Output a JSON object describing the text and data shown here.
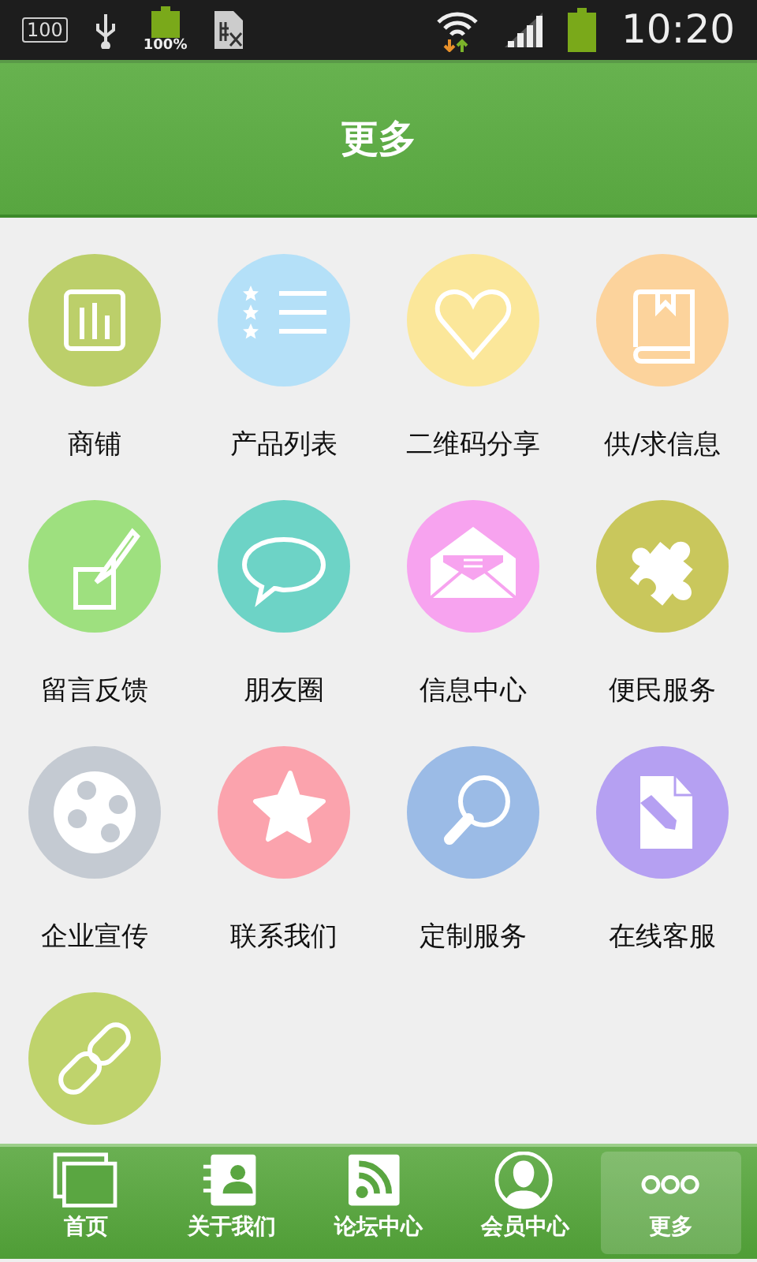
{
  "status_bar": {
    "notification_count": "100",
    "battery_percent": "100%",
    "time": "10:20"
  },
  "header": {
    "title": "更多"
  },
  "items": [
    {
      "label": "商铺",
      "color": "#bccf6a"
    },
    {
      "label": "产品列表",
      "color": "#b4e0f8"
    },
    {
      "label": "二维码分享",
      "color": "#fbe79a"
    },
    {
      "label": "供/求信息",
      "color": "#fcd39c"
    },
    {
      "label": "留言反馈",
      "color": "#9ee07f"
    },
    {
      "label": "朋友圈",
      "color": "#6dd3c6"
    },
    {
      "label": "信息中心",
      "color": "#f7a3ef"
    },
    {
      "label": "便民服务",
      "color": "#c9c75c"
    },
    {
      "label": "企业宣传",
      "color": "#c4cad2"
    },
    {
      "label": "联系我们",
      "color": "#fba3ad"
    },
    {
      "label": "定制服务",
      "color": "#9bbbe6"
    },
    {
      "label": "在线客服",
      "color": "#b5a0f2"
    },
    {
      "color": "#bfd36c"
    }
  ],
  "bottom_nav": [
    {
      "label": "首页",
      "selected": false
    },
    {
      "label": "关于我们",
      "selected": false
    },
    {
      "label": "论坛中心",
      "selected": false
    },
    {
      "label": "会员中心",
      "selected": false
    },
    {
      "label": "更多",
      "selected": true
    }
  ]
}
